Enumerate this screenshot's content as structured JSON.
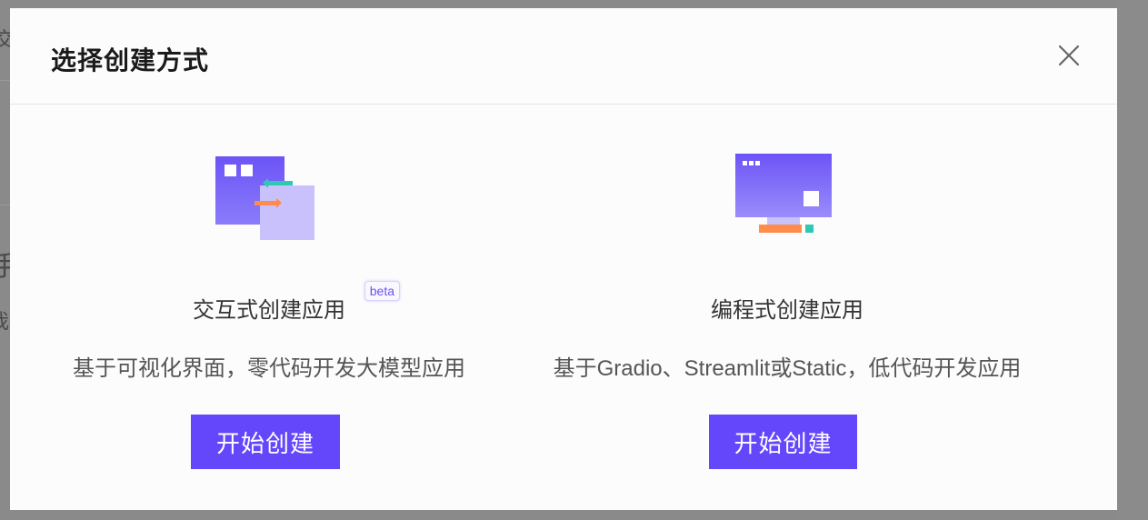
{
  "background": {
    "fragments": [
      "交",
      "手",
      "我"
    ]
  },
  "modal": {
    "title": "选择创建方式",
    "close_icon": "close-icon"
  },
  "options": [
    {
      "name": "交互式创建应用",
      "badge": "beta",
      "description": "基于可视化界面，零代码开发大模型应用",
      "button_label": "开始创建",
      "icon": "interactive-windows-icon"
    },
    {
      "name": "编程式创建应用",
      "description": "基于Gradio、Streamlit或Static，低代码开发应用",
      "button_label": "开始创建",
      "icon": "monitor-icon"
    }
  ],
  "colors": {
    "accent": "#6547fb",
    "overlay": "#808080",
    "modal_bg": "#fcfcfc",
    "arrow_teal": "#2ec9b5",
    "arrow_orange": "#ff8c4b",
    "light_purple": "#c9c1fc"
  }
}
